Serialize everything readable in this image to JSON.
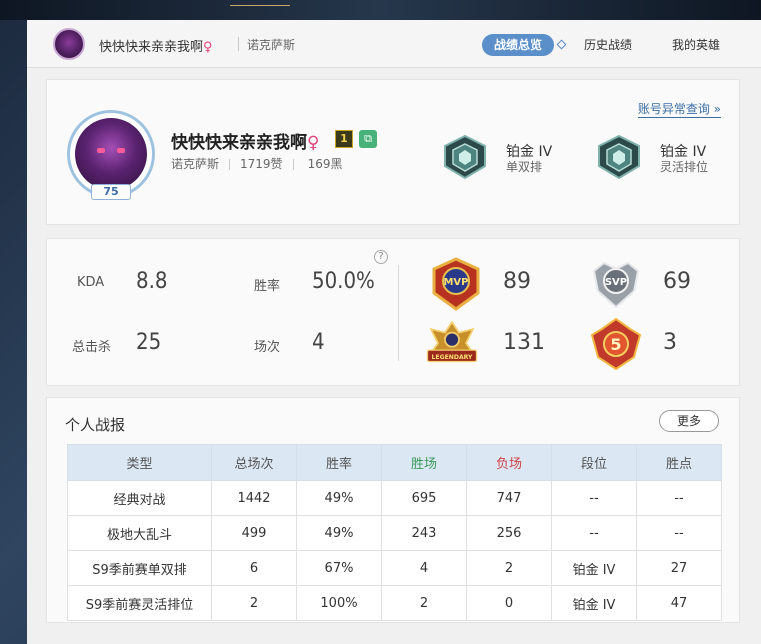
{
  "header": {
    "name": "快快快来亲亲我啊",
    "gender_symbol": "♀",
    "server": "诺克萨斯",
    "tabs": [
      {
        "label": "战绩总览",
        "active": true
      },
      {
        "label": "历史战绩",
        "active": false
      },
      {
        "label": "我的英雄",
        "active": false
      }
    ]
  },
  "profile": {
    "name": "快快快来亲亲我啊",
    "gender_symbol": "♀",
    "honor_badge": "1",
    "level": "75",
    "server": "诺克萨斯",
    "likes": "1719赞",
    "blacks": "169黑",
    "abnormal_link": "账号异常查询 »",
    "ranks": [
      {
        "tier": "铂金 IV",
        "queue": "单双排"
      },
      {
        "tier": "铂金 IV",
        "queue": "灵活排位"
      }
    ]
  },
  "summary": {
    "help": "?",
    "stats": [
      {
        "label": "KDA",
        "value": "8.8"
      },
      {
        "label": "胜率",
        "value": "50.0%"
      },
      {
        "label": "总击杀",
        "value": "25"
      },
      {
        "label": "场次",
        "value": "4"
      }
    ],
    "awards": [
      {
        "icon": "mvp-badge-icon",
        "text": "MVP",
        "count": "89"
      },
      {
        "icon": "svp-badge-icon",
        "text": "SVP",
        "count": "69"
      },
      {
        "icon": "legendary-badge-icon",
        "text": "LEGENDARY",
        "count": "131"
      },
      {
        "icon": "pentakill-badge-icon",
        "text": "5",
        "count": "3"
      }
    ]
  },
  "report": {
    "title": "个人战报",
    "more": "更多",
    "headers": [
      "类型",
      "总场次",
      "胜率",
      "胜场",
      "负场",
      "段位",
      "胜点"
    ],
    "rows": [
      [
        "经典对战",
        "1442",
        "49%",
        "695",
        "747",
        "--",
        "--"
      ],
      [
        "极地大乱斗",
        "499",
        "49%",
        "243",
        "256",
        "--",
        "--"
      ],
      [
        "S9季前赛单双排",
        "6",
        "67%",
        "4",
        "2",
        "铂金 IV",
        "27"
      ],
      [
        "S9季前赛灵活排位",
        "2",
        "100%",
        "2",
        "0",
        "铂金 IV",
        "47"
      ]
    ]
  },
  "colors": {
    "accent": "#5b8fc9",
    "win": "#3a9a5a",
    "loss": "#d0434a",
    "female": "#e0457b"
  }
}
